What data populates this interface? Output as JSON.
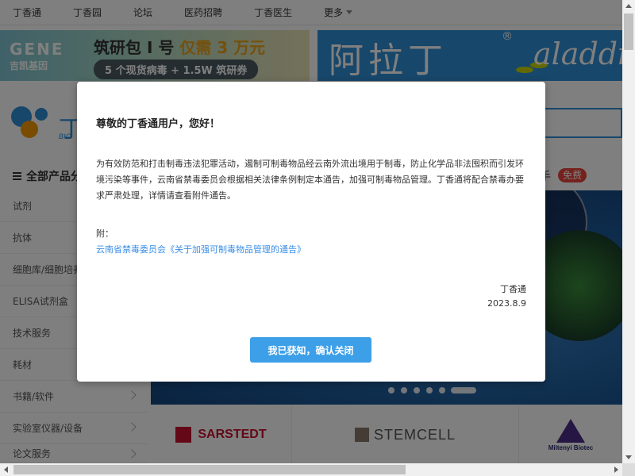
{
  "topnav": {
    "items": [
      "丁香通",
      "丁香园",
      "论坛",
      "医药招聘",
      "丁香医生"
    ],
    "more": "更多"
  },
  "ads": {
    "left": {
      "logo_big": "GENE",
      "logo_small": "吉凯基因",
      "title_prefix": "筑研包 I 号",
      "title_highlight": "仅需 3 万元",
      "subtitle": "5 个现货病毒 + 1.5W 筑研券"
    },
    "right": {
      "brand_cn": "阿拉丁",
      "brand_en": "aladdin",
      "registered": "®"
    }
  },
  "header": {
    "logo_text": "丁",
    "logo_sub": "BIO"
  },
  "sidebar": {
    "heading": "全部产品分",
    "items": [
      {
        "label": "试剂",
        "chevron": false
      },
      {
        "label": "抗体",
        "chevron": false
      },
      {
        "label": "细胞库/细胞培养",
        "chevron": false
      },
      {
        "label": "ELISA试剂盒",
        "chevron": false
      },
      {
        "label": "技术服务",
        "chevron": false
      },
      {
        "label": "耗材",
        "chevron": false
      },
      {
        "label": "书籍/软件",
        "chevron": true
      },
      {
        "label": "实验室仪器/设备",
        "chevron": true
      },
      {
        "label": "论文服务",
        "chevron": true
      }
    ]
  },
  "right_panel": {
    "shop_tag": "手",
    "free_badge": "免费"
  },
  "brands": {
    "sarstedt": "SARSTEDT",
    "stemcell": "STEMCELL",
    "miltenyi": "Miltenyi Biotec"
  },
  "modal": {
    "title": "尊敬的丁香通用户，您好！",
    "body": "为有效防范和打击制毒违法犯罪活动，遏制可制毒物品经云南外流出境用于制毒，防止化学品非法囤积而引发环境污染等事件，云南省禁毒委员会根据相关法律条例制定本通告，加强可制毒物品管理。丁香通将配合禁毒办要求严肃处理，详情请查看附件通告。",
    "attachment_label": "附：",
    "attachment_link": "云南省禁毒委员会《关于加强可制毒物品管理的通告》",
    "signature": "丁香通",
    "date": "2023.8.9",
    "confirm_button": "我已获知，确认关闭"
  },
  "colors": {
    "accent": "#3d9fe8",
    "link": "#3a8ee6",
    "badge": "#e8453c",
    "brand_blue": "#2f8fd6"
  }
}
